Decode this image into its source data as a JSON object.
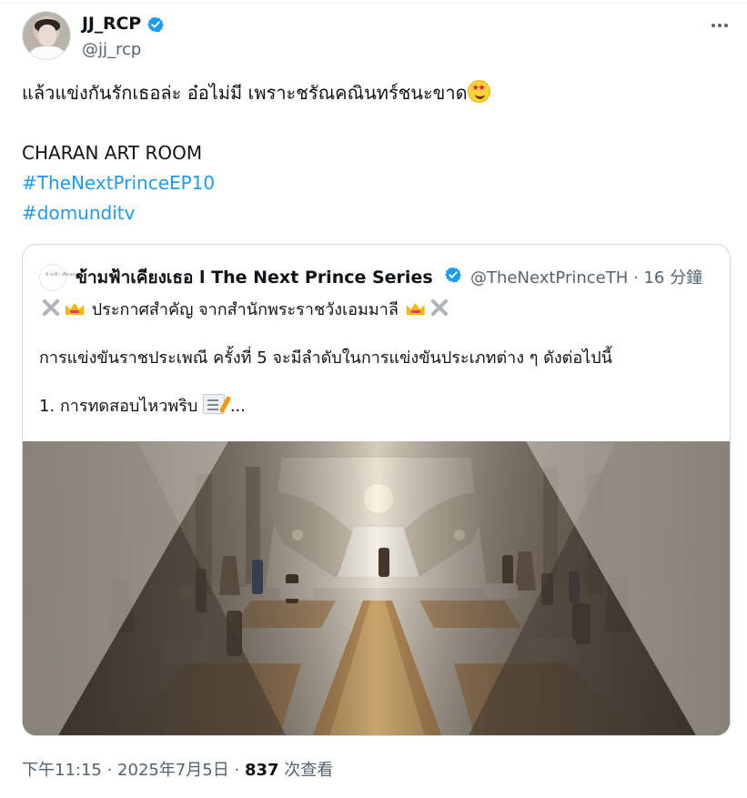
{
  "account": {
    "display_name": "JJ_RCP",
    "handle": "@jj_rcp",
    "verified": true
  },
  "tweet": {
    "lines": [
      "แล้วแข่งกันรักเธอล่ะ อ๋อไม่มี เพราะชรัณคณินทร์ชนะขาด",
      "",
      "CHARAN ART ROOM"
    ],
    "hashtags": [
      "#TheNextPrinceEP10",
      "#domunditv"
    ],
    "emoji_name": "star-struck-icon"
  },
  "quoted_tweet": {
    "display_name": "ข้ามฟ้าเคียงเธอ l The Next Prince Series",
    "handle": "@TheNextPrinceTH",
    "time": "· 16 分鐘",
    "verified": true,
    "logo_text": "ข้ามฟ้า เคียงเธอ",
    "text": {
      "line1": "ประกาศสำคัญ จากสำนักพระราชวังเอมมาลี",
      "line2": "การแข่งขันราชประเพณี ครั้งที่ 5 จะมีลำดับในการแข่งขันประเภทต่าง ๆ ดังต่อไปนี้",
      "line3": "1. การทดสอบไหวพริบ",
      "ellipsis": "..."
    },
    "media": {
      "type": "image",
      "description_icon": "palace-hall-image"
    }
  },
  "meta": {
    "timestamp": "下午11:15 · 2025年7月5日 ·",
    "views_count": "837",
    "views_label": "次查看"
  },
  "colors": {
    "primary_text": "#0f1419",
    "secondary_text": "#536471",
    "link": "#1d9bf0",
    "border": "#cfd9de"
  }
}
